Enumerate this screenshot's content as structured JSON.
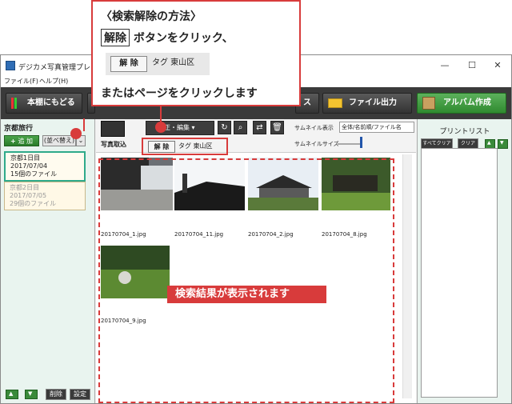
{
  "window": {
    "title": "デジカメ写真管理プレミアム",
    "controls": [
      "—",
      "☐",
      "✕"
    ]
  },
  "menu": [
    "ファイル(F)",
    "ヘルプ(H)"
  ],
  "toolbar": {
    "back_label": "本棚にもどる",
    "partial_label": "ス",
    "export_label": "ファイル出力",
    "album_label": "アルバム作成"
  },
  "left": {
    "title": "京都旅行",
    "add_label": "追 加",
    "sort_label": "(並べ替え)",
    "albums": [
      {
        "line1": "京都1日目",
        "line2": "2017/07/04",
        "line3": "15個のファイル"
      },
      {
        "line1": "京都2日目",
        "line2": "2017/07/05",
        "line3": "29個のファイル"
      }
    ],
    "bottom": {
      "up": "▲",
      "down": "▼",
      "delete_label": "削除",
      "settings_label": "設定"
    }
  },
  "center": {
    "import_label": "写真取込",
    "edit_label": "補正・編集",
    "thumb_view_label": "サムネイル表示",
    "thumb_view_value": "全体/名前順/ファイル名",
    "thumb_size_label": "サムネイルサイズ",
    "tag_clear_label": "解 除",
    "tag_text": "タグ 東山区",
    "photos": [
      {
        "name": "20170704_1.jpg"
      },
      {
        "name": "20170704_11.jpg"
      },
      {
        "name": "20170704_2.jpg"
      },
      {
        "name": "20170704_8.jpg"
      },
      {
        "name": "20170704_9.jpg"
      }
    ]
  },
  "right": {
    "title": "プリントリスト",
    "select_all_label": "すべてクリア",
    "clear_label": "クリア",
    "up": "▲",
    "down": "▼"
  },
  "callout": {
    "heading": "〈検索解除の方法〉",
    "button_word": "解除",
    "line2_rest": "ボタンをクリック、",
    "demo_button": "解 除",
    "demo_tag": "タグ 東山区",
    "line3": "またはページをクリックします"
  },
  "result_banner": "検索結果が表示されます",
  "colors": {
    "accent_red": "#d83b3b",
    "toolbar_dark": "#3a3a3a",
    "panel_mint": "#e9f4ef",
    "green": "#2f8a2f"
  }
}
